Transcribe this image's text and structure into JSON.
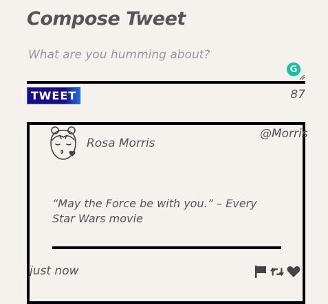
{
  "compose": {
    "title": "Compose Tweet",
    "placeholder": "What are you humming about?",
    "value": "",
    "grammarly_badge": "G",
    "button_label": "TWEET",
    "char_count": "87"
  },
  "tweet": {
    "avatar_icon": "girl-blowing-kiss-icon",
    "name": "Rosa Morris",
    "handle": "@Morris",
    "text": "“May the Force be with you.” – Every Star Wars movie",
    "timestamp": "just now",
    "actions": [
      "flag-icon",
      "retweet-icon",
      "heart-icon"
    ]
  },
  "colors": {
    "background": "#f5f2ed",
    "button_bg": "#1a0a8c",
    "button_accent": "#1d6fd8",
    "grammarly": "#15c39a",
    "rule": "#000000",
    "text": "#555555"
  }
}
